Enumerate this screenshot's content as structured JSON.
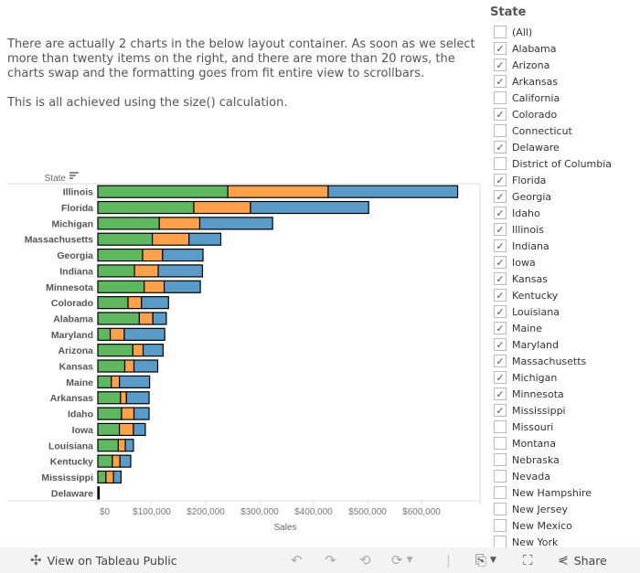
{
  "description": {
    "paragraph1": "There are actually 2 charts in the below layout container. As soon as we select more than twenty items on the right, and there are more than 20 rows, the charts swap and the formatting goes from fit entire view to scrollbars.",
    "paragraph2": "This is all achieved using the size() calculation."
  },
  "chart_data": {
    "type": "bar",
    "orientation": "horizontal",
    "stacked": true,
    "row_header": "State",
    "xlabel": "Sales",
    "xlim": [
      0,
      700000
    ],
    "xticks": [
      "$0",
      "$100,000",
      "$200,000",
      "$300,000",
      "$400,000",
      "$500,000",
      "$600,000"
    ],
    "xtick_values": [
      0,
      100000,
      200000,
      300000,
      400000,
      500000,
      600000
    ],
    "grid": false,
    "colors": [
      "#5fb760",
      "#ffa24b",
      "#5b9bc8"
    ],
    "categories": [
      "Illinois",
      "Florida",
      "Michigan",
      "Massachusetts",
      "Georgia",
      "Indiana",
      "Minnesota",
      "Colorado",
      "Alabama",
      "Maryland",
      "Arizona",
      "Kansas",
      "Maine",
      "Arkansas",
      "Idaho",
      "Iowa",
      "Louisiana",
      "Kentucky",
      "Mississippi",
      "Delaware"
    ],
    "series": [
      {
        "values": [
          241000,
          178000,
          114000,
          101000,
          83000,
          68000,
          86000,
          56000,
          77000,
          23000,
          65000,
          50000,
          25000,
          42000,
          44000,
          40000,
          38000,
          27000,
          15000,
          1000
        ]
      },
      {
        "values": [
          186000,
          105000,
          75000,
          68000,
          37000,
          44000,
          37000,
          25000,
          25000,
          26000,
          19000,
          17000,
          15000,
          11000,
          23000,
          26000,
          13000,
          14000,
          14000,
          500
        ]
      },
      {
        "values": [
          240000,
          219000,
          135000,
          59000,
          75000,
          82000,
          67000,
          50000,
          25000,
          75000,
          37000,
          44000,
          56000,
          42000,
          28000,
          22000,
          15000,
          20000,
          14000,
          1000
        ]
      }
    ]
  },
  "filter": {
    "title": "State",
    "items": [
      {
        "label": "(All)",
        "checked": false
      },
      {
        "label": "Alabama",
        "checked": true
      },
      {
        "label": "Arizona",
        "checked": true
      },
      {
        "label": "Arkansas",
        "checked": true
      },
      {
        "label": "California",
        "checked": false
      },
      {
        "label": "Colorado",
        "checked": true
      },
      {
        "label": "Connecticut",
        "checked": false
      },
      {
        "label": "Delaware",
        "checked": true
      },
      {
        "label": "District of Columbia",
        "checked": false
      },
      {
        "label": "Florida",
        "checked": true
      },
      {
        "label": "Georgia",
        "checked": true
      },
      {
        "label": "Idaho",
        "checked": true
      },
      {
        "label": "Illinois",
        "checked": true
      },
      {
        "label": "Indiana",
        "checked": true
      },
      {
        "label": "Iowa",
        "checked": true
      },
      {
        "label": "Kansas",
        "checked": true
      },
      {
        "label": "Kentucky",
        "checked": true
      },
      {
        "label": "Louisiana",
        "checked": true
      },
      {
        "label": "Maine",
        "checked": true
      },
      {
        "label": "Maryland",
        "checked": true
      },
      {
        "label": "Massachusetts",
        "checked": true
      },
      {
        "label": "Michigan",
        "checked": true
      },
      {
        "label": "Minnesota",
        "checked": true
      },
      {
        "label": "Mississippi",
        "checked": true
      },
      {
        "label": "Missouri",
        "checked": false
      },
      {
        "label": "Montana",
        "checked": false
      },
      {
        "label": "Nebraska",
        "checked": false
      },
      {
        "label": "Nevada",
        "checked": false
      },
      {
        "label": "New Hampshire",
        "checked": false
      },
      {
        "label": "New Jersey",
        "checked": false
      },
      {
        "label": "New Mexico",
        "checked": false
      },
      {
        "label": "New York",
        "checked": false
      }
    ]
  },
  "toolbar": {
    "view_on_public": "View on Tableau Public",
    "share": "Share"
  }
}
